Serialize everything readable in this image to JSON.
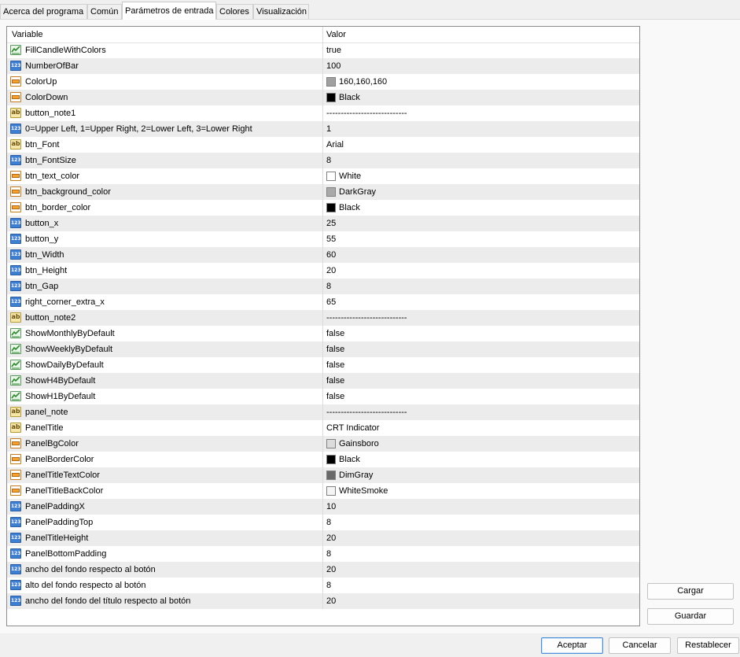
{
  "tabs": [
    {
      "label": "Acerca del programa",
      "active": false
    },
    {
      "label": "Común",
      "active": false
    },
    {
      "label": "Parámetros de entrada",
      "active": true
    },
    {
      "label": "Colores",
      "active": false
    },
    {
      "label": "Visualización",
      "active": false
    }
  ],
  "grid": {
    "headers": {
      "variable": "Variable",
      "valor": "Valor"
    },
    "rows": [
      {
        "type": "bool",
        "icon": "bool-icon",
        "name": "FillCandleWithColors",
        "value": "true"
      },
      {
        "type": "num",
        "icon": "number-icon",
        "name": "NumberOfBar",
        "value": "100"
      },
      {
        "type": "color",
        "icon": "color-icon",
        "name": "ColorUp",
        "value": "160,160,160",
        "swatch": "#a0a0a0"
      },
      {
        "type": "color",
        "icon": "color-icon",
        "name": "ColorDown",
        "value": "Black",
        "swatch": "#000000"
      },
      {
        "type": "str",
        "icon": "string-icon",
        "name": "button_note1",
        "value": "----------------------------"
      },
      {
        "type": "num",
        "icon": "number-icon",
        "name": "0=Upper Left, 1=Upper Right, 2=Lower Left, 3=Lower Right",
        "value": "1"
      },
      {
        "type": "str",
        "icon": "string-icon",
        "name": "btn_Font",
        "value": "Arial"
      },
      {
        "type": "num",
        "icon": "number-icon",
        "name": "btn_FontSize",
        "value": "8"
      },
      {
        "type": "color",
        "icon": "color-icon",
        "name": "btn_text_color",
        "value": "White",
        "swatch": "#ffffff"
      },
      {
        "type": "color",
        "icon": "color-icon",
        "name": "btn_background_color",
        "value": "DarkGray",
        "swatch": "#a9a9a9"
      },
      {
        "type": "color",
        "icon": "color-icon",
        "name": "btn_border_color",
        "value": "Black",
        "swatch": "#000000"
      },
      {
        "type": "num",
        "icon": "number-icon",
        "name": "button_x",
        "value": "25"
      },
      {
        "type": "num",
        "icon": "number-icon",
        "name": "button_y",
        "value": "55"
      },
      {
        "type": "num",
        "icon": "number-icon",
        "name": "btn_Width",
        "value": "60"
      },
      {
        "type": "num",
        "icon": "number-icon",
        "name": "btn_Height",
        "value": "20"
      },
      {
        "type": "num",
        "icon": "number-icon",
        "name": "btn_Gap",
        "value": "8"
      },
      {
        "type": "num",
        "icon": "number-icon",
        "name": "right_corner_extra_x",
        "value": "65"
      },
      {
        "type": "str",
        "icon": "string-icon",
        "name": "button_note2",
        "value": "----------------------------"
      },
      {
        "type": "bool",
        "icon": "bool-icon",
        "name": "ShowMonthlyByDefault",
        "value": "false"
      },
      {
        "type": "bool",
        "icon": "bool-icon",
        "name": "ShowWeeklyByDefault",
        "value": "false"
      },
      {
        "type": "bool",
        "icon": "bool-icon",
        "name": "ShowDailyByDefault",
        "value": "false"
      },
      {
        "type": "bool",
        "icon": "bool-icon",
        "name": "ShowH4ByDefault",
        "value": "false"
      },
      {
        "type": "bool",
        "icon": "bool-icon",
        "name": "ShowH1ByDefault",
        "value": "false"
      },
      {
        "type": "str",
        "icon": "string-icon",
        "name": "panel_note",
        "value": "----------------------------"
      },
      {
        "type": "str",
        "icon": "string-icon",
        "name": "PanelTitle",
        "value": "CRT Indicator"
      },
      {
        "type": "color",
        "icon": "color-icon",
        "name": "PanelBgColor",
        "value": "Gainsboro",
        "swatch": "#dcdcdc"
      },
      {
        "type": "color",
        "icon": "color-icon",
        "name": "PanelBorderColor",
        "value": "Black",
        "swatch": "#000000"
      },
      {
        "type": "color",
        "icon": "color-icon",
        "name": "PanelTitleTextColor",
        "value": "DimGray",
        "swatch": "#696969"
      },
      {
        "type": "color",
        "icon": "color-icon",
        "name": "PanelTitleBackColor",
        "value": "WhiteSmoke",
        "swatch": "#f5f5f5"
      },
      {
        "type": "num",
        "icon": "number-icon",
        "name": "PanelPaddingX",
        "value": "10"
      },
      {
        "type": "num",
        "icon": "number-icon",
        "name": "PanelPaddingTop",
        "value": "8"
      },
      {
        "type": "num",
        "icon": "number-icon",
        "name": "PanelTitleHeight",
        "value": "20"
      },
      {
        "type": "num",
        "icon": "number-icon",
        "name": "PanelBottomPadding",
        "value": "8"
      },
      {
        "type": "num",
        "icon": "number-icon",
        "name": "ancho del fondo respecto al botón",
        "value": "20"
      },
      {
        "type": "num",
        "icon": "number-icon",
        "name": "alto del fondo respecto al botón",
        "value": "8"
      },
      {
        "type": "num",
        "icon": "number-icon",
        "name": "ancho del fondo del título respecto al botón",
        "value": "20"
      }
    ]
  },
  "side_buttons": {
    "cargar": "Cargar",
    "guardar": "Guardar"
  },
  "footer": {
    "aceptar": "Aceptar",
    "cancelar": "Cancelar",
    "restablecer": "Restablecer"
  }
}
